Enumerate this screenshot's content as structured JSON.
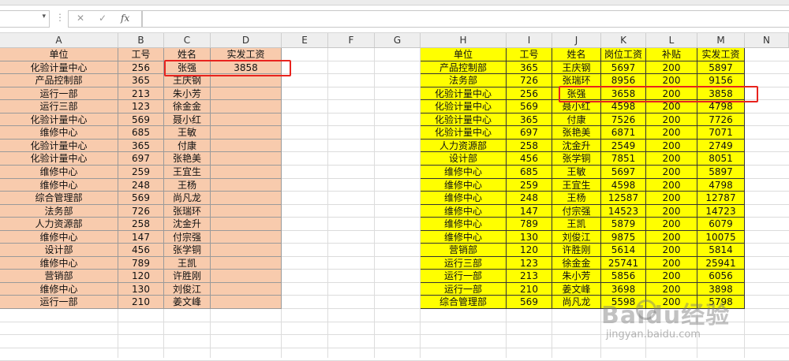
{
  "formula_bar": {
    "name_box": "",
    "dropdown_glyph": "▾",
    "sep_glyph": "⋮",
    "cancel_glyph": "✕",
    "enter_glyph": "✓",
    "fx_label": "fx",
    "formula": ""
  },
  "columns": [
    "A",
    "B",
    "C",
    "D",
    "E",
    "F",
    "G",
    "H",
    "I",
    "J",
    "K",
    "L",
    "M",
    "N"
  ],
  "left_table": {
    "headers": [
      "单位",
      "工号",
      "姓名",
      "实发工资"
    ],
    "rows": [
      [
        "化验计量中心",
        "256",
        "张强",
        "3858"
      ],
      [
        "产品控制部",
        "365",
        "王庆钢",
        ""
      ],
      [
        "运行一部",
        "213",
        "朱小芳",
        ""
      ],
      [
        "运行三部",
        "123",
        "徐金金",
        ""
      ],
      [
        "化验计量中心",
        "569",
        "聂小红",
        ""
      ],
      [
        "维修中心",
        "685",
        "王敏",
        ""
      ],
      [
        "化验计量中心",
        "365",
        "付康",
        ""
      ],
      [
        "化验计量中心",
        "697",
        "张艳美",
        ""
      ],
      [
        "维修中心",
        "259",
        "王宜生",
        ""
      ],
      [
        "维修中心",
        "248",
        "王杨",
        ""
      ],
      [
        "综合管理部",
        "569",
        "尚凡龙",
        ""
      ],
      [
        "法务部",
        "726",
        "张瑞环",
        ""
      ],
      [
        "人力资源部",
        "258",
        "沈金升",
        ""
      ],
      [
        "维修中心",
        "147",
        "付宗强",
        ""
      ],
      [
        "设计部",
        "456",
        "张学铜",
        ""
      ],
      [
        "维修中心",
        "789",
        "王凯",
        ""
      ],
      [
        "营销部",
        "120",
        "许胜刚",
        ""
      ],
      [
        "维修中心",
        "130",
        "刘俊江",
        ""
      ],
      [
        "运行一部",
        "210",
        "姜文峰",
        ""
      ]
    ]
  },
  "right_table": {
    "headers": [
      "单位",
      "工号",
      "姓名",
      "岗位工资",
      "补贴",
      "实发工资"
    ],
    "rows": [
      [
        "产品控制部",
        "365",
        "王庆钢",
        "5697",
        "200",
        "5897"
      ],
      [
        "法务部",
        "726",
        "张瑞环",
        "8956",
        "200",
        "9156"
      ],
      [
        "化验计量中心",
        "256",
        "张强",
        "3658",
        "200",
        "3858"
      ],
      [
        "化验计量中心",
        "569",
        "聂小红",
        "4598",
        "200",
        "4798"
      ],
      [
        "化验计量中心",
        "365",
        "付康",
        "7526",
        "200",
        "7726"
      ],
      [
        "化验计量中心",
        "697",
        "张艳美",
        "6871",
        "200",
        "7071"
      ],
      [
        "人力资源部",
        "258",
        "沈金升",
        "2549",
        "200",
        "2749"
      ],
      [
        "设计部",
        "456",
        "张学铜",
        "7851",
        "200",
        "8051"
      ],
      [
        "维修中心",
        "685",
        "王敏",
        "5697",
        "200",
        "5897"
      ],
      [
        "维修中心",
        "259",
        "王宜生",
        "4598",
        "200",
        "4798"
      ],
      [
        "维修中心",
        "248",
        "王杨",
        "12587",
        "200",
        "12787"
      ],
      [
        "维修中心",
        "147",
        "付宗强",
        "14523",
        "200",
        "14723"
      ],
      [
        "维修中心",
        "789",
        "王凯",
        "5879",
        "200",
        "6079"
      ],
      [
        "维修中心",
        "130",
        "刘俊江",
        "9875",
        "200",
        "10075"
      ],
      [
        "营销部",
        "120",
        "许胜刚",
        "5614",
        "200",
        "5814"
      ],
      [
        "运行三部",
        "123",
        "徐金金",
        "25741",
        "200",
        "25941"
      ],
      [
        "运行一部",
        "213",
        "朱小芳",
        "5856",
        "200",
        "6056"
      ],
      [
        "运行一部",
        "210",
        "姜文峰",
        "3698",
        "200",
        "3898"
      ],
      [
        "综合管理部",
        "569",
        "尚凡龙",
        "5598",
        "200",
        "5798"
      ]
    ]
  },
  "colors": {
    "left_fill": "#f8cbad",
    "right_fill": "#ffff00",
    "highlight_border": "#e8231e"
  },
  "watermark": {
    "brand": "Baidu经验",
    "url": "jingyan.baidu.com"
  }
}
